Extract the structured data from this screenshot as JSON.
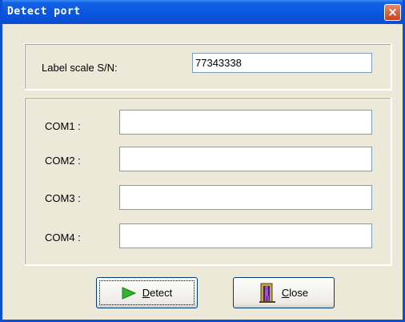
{
  "window": {
    "title": "Detect port",
    "close_glyph": "×"
  },
  "scale": {
    "label": "Label scale S/N:",
    "value": "77343338"
  },
  "ports": [
    {
      "label": "COM1 :",
      "value": ""
    },
    {
      "label": "COM2 :",
      "value": ""
    },
    {
      "label": "COM3 :",
      "value": ""
    },
    {
      "label": "COM4 :",
      "value": ""
    }
  ],
  "buttons": {
    "detect": {
      "label": "Detect",
      "mnemonic": "D",
      "rest": "etect",
      "icon": "play-arrow-icon",
      "icon_color": "#2fb52b"
    },
    "close": {
      "label": "Close",
      "mnemonic": "C",
      "rest": "lose",
      "icon": "door-exit-icon"
    }
  },
  "colors": {
    "titlebar": "#0b56de",
    "dialog_bg": "#ece9d8",
    "field_border": "#7f9db9"
  }
}
